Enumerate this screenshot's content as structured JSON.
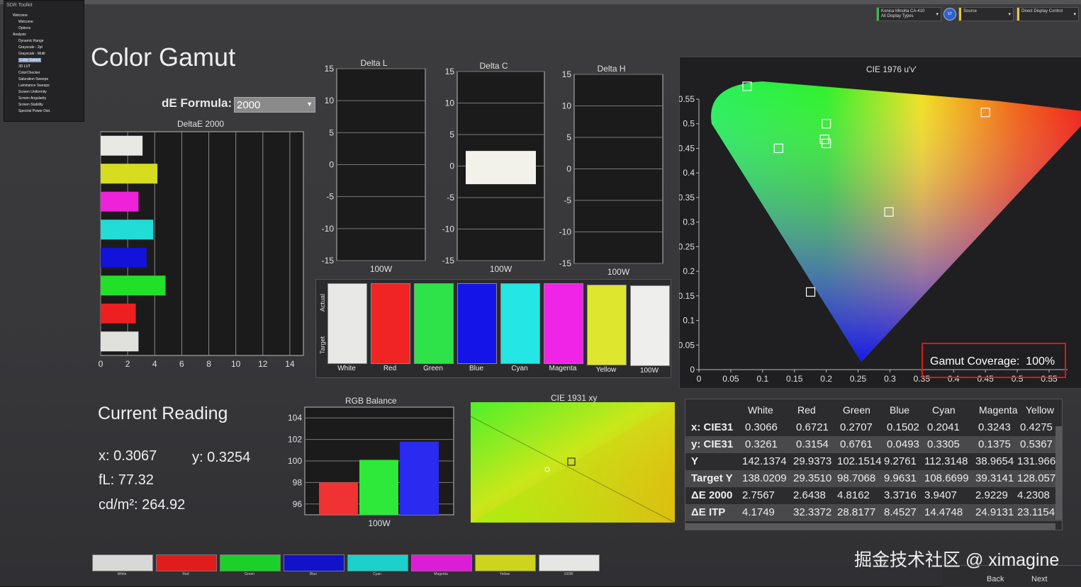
{
  "app": {
    "name": "SDR Toolkit"
  },
  "sidebar": {
    "items": [
      {
        "label": "Welcome",
        "indent": 0
      },
      {
        "label": "Welcome",
        "indent": 1
      },
      {
        "label": "Options",
        "indent": 1
      },
      {
        "label": "Analysis",
        "indent": 0
      },
      {
        "label": "Dynamic Range",
        "indent": 1
      },
      {
        "label": "Grayscale - 2pt",
        "indent": 1
      },
      {
        "label": "Grayscale - Multi",
        "indent": 1
      },
      {
        "label": "Color Gamut",
        "indent": 1,
        "selected": true
      },
      {
        "label": "3D LUT",
        "indent": 1
      },
      {
        "label": "ColorChecker",
        "indent": 1
      },
      {
        "label": "Saturation Sweeps",
        "indent": 1
      },
      {
        "label": "Luminance Sweeps",
        "indent": 1
      },
      {
        "label": "Screen Uniformity",
        "indent": 1
      },
      {
        "label": "Screen Angularity",
        "indent": 1
      },
      {
        "label": "Screen Stability",
        "indent": 1
      },
      {
        "label": "Spectral Power Dist.",
        "indent": 1
      }
    ]
  },
  "controls": {
    "meter_line1": "Konica Minolta CA-410",
    "meter_line2": "All Display Types",
    "meter_color": "#2fbf4a",
    "circle_label": "ST",
    "source_label": "Source",
    "source_color": "#e9c93a",
    "display_label": "Direct Display Control",
    "display_color": "#e9c93a"
  },
  "page": {
    "title": "Color Gamut"
  },
  "de_formula": {
    "label": "dE Formula:",
    "value": "2000"
  },
  "deltaE_chart": {
    "title": "DeltaE 2000",
    "xticks": [
      "0",
      "2",
      "4",
      "6",
      "8",
      "10",
      "12",
      "14"
    ],
    "bars": [
      {
        "name": "White",
        "value": 3.1,
        "color": "#e8e8e4"
      },
      {
        "name": "Yellow",
        "value": 4.2,
        "color": "#d6dc1f"
      },
      {
        "name": "Magenta",
        "value": 2.8,
        "color": "#ee22d8"
      },
      {
        "name": "Cyan",
        "value": 3.9,
        "color": "#22dcd6"
      },
      {
        "name": "Blue",
        "value": 3.4,
        "color": "#1212d8"
      },
      {
        "name": "Green",
        "value": 4.8,
        "color": "#22e02a"
      },
      {
        "name": "Red",
        "value": 2.6,
        "color": "#ec2020"
      },
      {
        "name": "100W",
        "value": 2.8,
        "color": "#e0e0dc"
      }
    ]
  },
  "delta_panels": [
    {
      "title": "Delta L",
      "xlabel": "100W",
      "yticks": [
        "15",
        "10",
        "5",
        "0",
        "-5",
        "-10",
        "-15"
      ],
      "bar_value": null
    },
    {
      "title": "Delta C",
      "xlabel": "100W",
      "yticks": [
        "15",
        "10",
        "5",
        "0",
        "-5",
        "-10",
        "-15"
      ],
      "bar_value": 2.4
    },
    {
      "title": "Delta H",
      "xlabel": "100W",
      "yticks": [
        "15",
        "10",
        "5",
        "0",
        "-5",
        "-10",
        "-15"
      ],
      "bar_value": null
    }
  ],
  "swatches": {
    "side_actual": "Actual",
    "side_target": "Target",
    "items": [
      {
        "label": "White",
        "color": "#e8e8e6"
      },
      {
        "label": "Red",
        "color": "#f02424"
      },
      {
        "label": "Green",
        "color": "#2ee34a"
      },
      {
        "label": "Blue",
        "color": "#1414e8"
      },
      {
        "label": "Cyan",
        "color": "#24e6e2"
      },
      {
        "label": "Magenta",
        "color": "#f024e6"
      },
      {
        "label": "Yellow",
        "color": "#dfe62e"
      },
      {
        "label": "100W",
        "color": "#eeeeec"
      }
    ]
  },
  "reading": {
    "title": "Current Reading",
    "x": "x: 0.3067",
    "y": "y: 0.3254",
    "fl": "fL: 77.32",
    "cdm2_label": "cd/m²: ",
    "cdm2_value": "264.92"
  },
  "rgb_balance": {
    "title": "RGB Balance",
    "xlabel": "100W",
    "yticks": [
      "104",
      "102",
      "100",
      "98",
      "96"
    ],
    "values": {
      "red": 98.0,
      "green": 100.1,
      "blue": 101.8
    }
  },
  "cie1931": {
    "title": "CIE 1931 xy"
  },
  "cie1976": {
    "title": "CIE 1976 u'v'",
    "yticks": [
      "0.55",
      "0.5",
      "0.45",
      "0.4",
      "0.35",
      "0.3",
      "0.25",
      "0.2",
      "0.15",
      "0.1",
      "0.05",
      "0"
    ],
    "xticks": [
      "0",
      "0.05",
      "0.1",
      "0.15",
      "0.2",
      "0.25",
      "0.3",
      "0.35",
      "0.4",
      "0.45",
      "0.5",
      "0.55"
    ],
    "gamut_label": "Gamut Coverage:",
    "gamut_value": "100%"
  },
  "table": {
    "headers": [
      "White",
      "Red",
      "Green",
      "Blue",
      "Cyan",
      "Magenta",
      "Yellow"
    ],
    "rows": [
      {
        "label": "x: CIE31",
        "values": [
          "0.3066",
          "0.6721",
          "0.2707",
          "0.1502",
          "0.2041",
          "0.3243",
          "0.4275"
        ]
      },
      {
        "label": "y: CIE31",
        "values": [
          "0.3261",
          "0.3154",
          "0.6761",
          "0.0493",
          "0.3305",
          "0.1375",
          "0.5367"
        ]
      },
      {
        "label": "Y",
        "values": [
          "142.1374",
          "29.9373",
          "102.1514",
          "9.2761",
          "112.3148",
          "38.9654",
          "131.966"
        ]
      },
      {
        "label": "Target Y",
        "values": [
          "138.0209",
          "29.3510",
          "98.7068",
          "9.9631",
          "108.6699",
          "39.3141",
          "128.057"
        ]
      },
      {
        "label": "ΔE 2000",
        "values": [
          "2.7567",
          "2.6438",
          "4.8162",
          "3.3716",
          "3.9407",
          "2.9229",
          "4.2308"
        ]
      },
      {
        "label": "ΔE ITP",
        "values": [
          "4.1749",
          "32.3372",
          "28.8177",
          "8.4527",
          "14.4748",
          "24.9131",
          "23.1154"
        ]
      }
    ]
  },
  "bottom_swatches": [
    {
      "label": "White",
      "color": "#d8d8d6"
    },
    {
      "label": "Red",
      "color": "#e01c1c"
    },
    {
      "label": "Green",
      "color": "#1cd02a"
    },
    {
      "label": "Blue",
      "color": "#1212c8"
    },
    {
      "label": "Cyan",
      "color": "#1cd0cc"
    },
    {
      "label": "Magenta",
      "color": "#dd1cd6"
    },
    {
      "label": "Yellow",
      "color": "#ccd41c"
    },
    {
      "label": "100W",
      "color": "#e6e6e4"
    }
  ],
  "nav": {
    "back": "Back",
    "next": "Next"
  },
  "watermark": "掘金技术社区 @ ximagine"
}
